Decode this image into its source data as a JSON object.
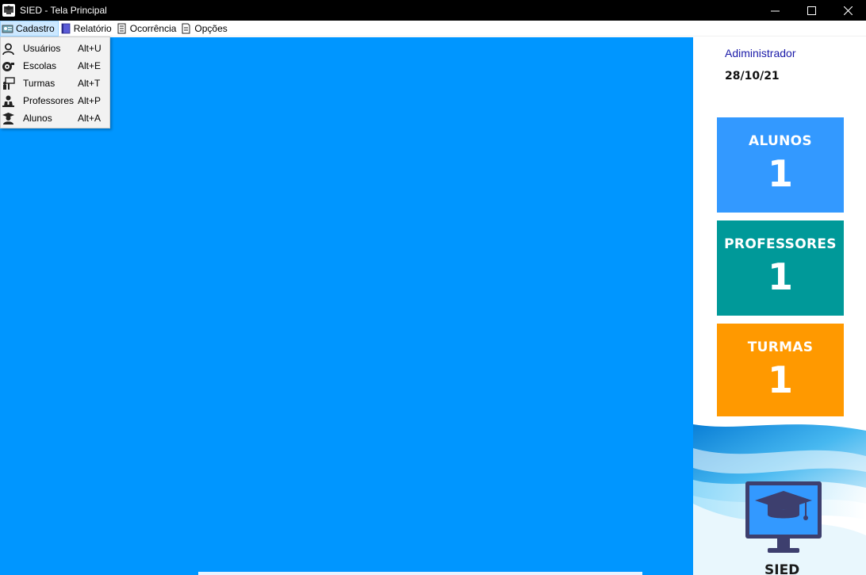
{
  "window": {
    "title": "SIED - Tela Principal",
    "controls": [
      "minimize",
      "maximize",
      "close"
    ]
  },
  "menubar": {
    "items": [
      {
        "label": "Cadastro",
        "icon": "cadastro-icon",
        "active": true
      },
      {
        "label": "Relatório",
        "icon": "book-icon"
      },
      {
        "label": "Ocorrência",
        "icon": "notepad-icon"
      },
      {
        "label": "Opções",
        "icon": "document-icon"
      }
    ]
  },
  "dropdown": {
    "items": [
      {
        "label": "Usuários",
        "shortcut": "Alt+U",
        "icon": "user-icon"
      },
      {
        "label": "Escolas",
        "shortcut": "Alt+E",
        "icon": "school-icon"
      },
      {
        "label": "Turmas",
        "shortcut": "Alt+T",
        "icon": "classroom-icon"
      },
      {
        "label": "Professores",
        "shortcut": "Alt+P",
        "icon": "teacher-icon"
      },
      {
        "label": "Alunos",
        "shortcut": "Alt+A",
        "icon": "student-icon"
      }
    ]
  },
  "side": {
    "user": "Adiministrador",
    "date": "28/10/21",
    "cards": [
      {
        "label": "ALUNOS",
        "value": "1",
        "color": "#3399ff"
      },
      {
        "label": "PROFESSORES",
        "value": "1",
        "color": "#009999"
      },
      {
        "label": "TURMAS",
        "value": "1",
        "color": "#ff9900"
      }
    ],
    "logo_text": "SIED"
  },
  "colors": {
    "main_bg": "#0096ff",
    "titlebar_bg": "#000000",
    "menu_active_bg": "#cce8ff"
  }
}
